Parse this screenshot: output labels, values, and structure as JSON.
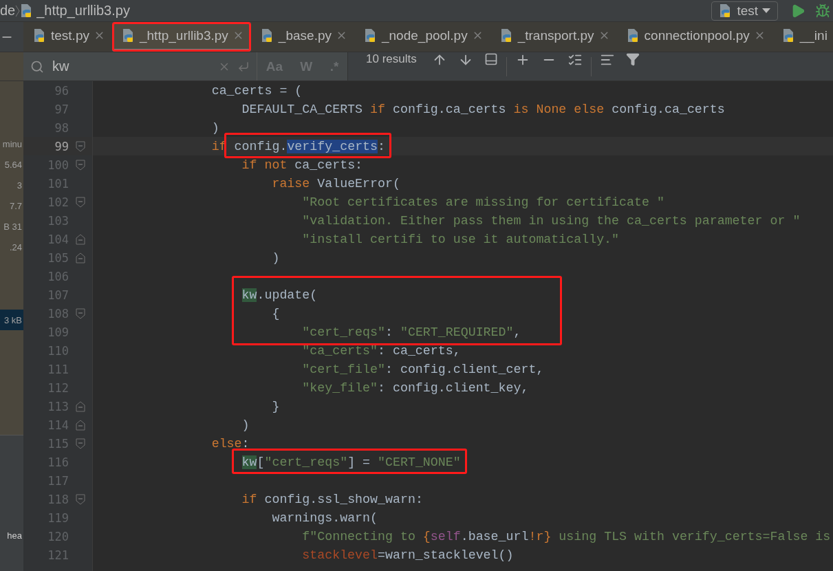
{
  "breadcrumb": {
    "items": [
      {
        "label": "de",
        "kind": "text"
      },
      {
        "label": "_http_urllib3.py",
        "kind": "file"
      }
    ]
  },
  "run_config": {
    "label": "test"
  },
  "tabs": [
    {
      "label": "test.py",
      "selected": false,
      "outlined": false
    },
    {
      "label": "_http_urllib3.py",
      "selected": true,
      "outlined": true
    },
    {
      "label": "_base.py",
      "selected": false,
      "outlined": false
    },
    {
      "label": "_node_pool.py",
      "selected": false,
      "outlined": false
    },
    {
      "label": "_transport.py",
      "selected": false,
      "outlined": false
    },
    {
      "label": "connectionpool.py",
      "selected": false,
      "outlined": false
    },
    {
      "label": "__ini",
      "selected": false,
      "outlined": false
    }
  ],
  "search": {
    "value": "kw",
    "toggles": [
      "Aa",
      "W",
      ".*"
    ],
    "results": "10 results"
  },
  "side_panel": {
    "top_items": [
      {
        "label": "minu",
        "selected": false
      },
      {
        "label": "5.64",
        "selected": false
      },
      {
        "label": "3",
        "selected": false
      },
      {
        "label": "7.7",
        "selected": false
      },
      {
        "label": "B 31",
        "selected": false
      },
      {
        "label": ".24",
        "selected": false
      },
      {
        "label": "3 kB",
        "selected": true
      }
    ],
    "bottom_items": [
      {
        "label": "hea",
        "selected": false
      }
    ]
  },
  "code": {
    "lines": [
      {
        "number": "96",
        "current": false,
        "tokens": [
          {
            "text": "            ca_certs = (",
            "kind": "plain"
          }
        ]
      },
      {
        "number": "97",
        "current": false,
        "tokens": [
          {
            "text": "                DEFAULT_CA_CERTS ",
            "kind": "plain"
          },
          {
            "text": "if",
            "kind": "keyword"
          },
          {
            "text": " config.ca_certs ",
            "kind": "plain"
          },
          {
            "text": "is",
            "kind": "keyword"
          },
          {
            "text": " None",
            "kind": "keyword"
          },
          {
            "text": " else",
            "kind": "keyword"
          },
          {
            "text": " config.ca_certs",
            "kind": "plain"
          }
        ]
      },
      {
        "number": "98",
        "current": false,
        "tokens": [
          {
            "text": "            )",
            "kind": "plain"
          }
        ]
      },
      {
        "number": "99",
        "current": true,
        "fold_start": true,
        "tokens": [
          {
            "text": "            if",
            "kind": "keyword"
          },
          {
            "text": " config.",
            "kind": "plain",
            "box_start": true
          },
          {
            "text": "verify_certs",
            "kind": "plain",
            "selected": true
          },
          {
            "text": ":",
            "kind": "plain",
            "box_end": true
          }
        ]
      },
      {
        "number": "100",
        "current": false,
        "fold_start": true,
        "tokens": [
          {
            "text": "                if not",
            "kind": "keyword"
          },
          {
            "text": " ca_certs:",
            "kind": "plain"
          }
        ]
      },
      {
        "number": "101",
        "current": false,
        "tokens": [
          {
            "text": "                    raise",
            "kind": "keyword"
          },
          {
            "text": " ValueError(",
            "kind": "plain"
          }
        ]
      },
      {
        "number": "102",
        "current": false,
        "fold_start": true,
        "tokens": [
          {
            "text": "                        \"Root certificates are missing for certificate \"",
            "kind": "string"
          }
        ]
      },
      {
        "number": "103",
        "current": false,
        "tokens": [
          {
            "text": "                        \"validation. Either pass them in using the ca_certs parameter or \"",
            "kind": "string"
          }
        ]
      },
      {
        "number": "104",
        "current": false,
        "fold_end": true,
        "tokens": [
          {
            "text": "                        \"install certifi to use it automatically.\"",
            "kind": "string"
          }
        ]
      },
      {
        "number": "105",
        "current": false,
        "fold_end": true,
        "tokens": [
          {
            "text": "                    )",
            "kind": "plain"
          }
        ]
      },
      {
        "number": "106",
        "current": false
      },
      {
        "number": "107",
        "current": false,
        "tokens": [
          {
            "text": "                kw",
            "kind": "plain",
            "match": true,
            "box_start": true
          },
          {
            "text": ".update(",
            "kind": "plain"
          }
        ]
      },
      {
        "number": "108",
        "current": false,
        "fold_start": true,
        "tokens": [
          {
            "text": "                    {",
            "kind": "plain"
          }
        ]
      },
      {
        "number": "109",
        "current": false,
        "tokens": [
          {
            "text": "                        \"cert_reqs\"",
            "kind": "string"
          },
          {
            "text": ": ",
            "kind": "plain"
          },
          {
            "text": "\"CERT_REQUIRED\"",
            "kind": "string"
          },
          {
            "text": ",",
            "kind": "plain",
            "box_end": true
          }
        ]
      },
      {
        "number": "110",
        "current": false,
        "tokens": [
          {
            "text": "                        \"ca_certs\"",
            "kind": "string"
          },
          {
            "text": ": ca_certs,",
            "kind": "plain"
          }
        ]
      },
      {
        "number": "111",
        "current": false,
        "tokens": [
          {
            "text": "                        \"cert_file\"",
            "kind": "string"
          },
          {
            "text": ": config.client_cert,",
            "kind": "plain"
          }
        ]
      },
      {
        "number": "112",
        "current": false,
        "tokens": [
          {
            "text": "                        \"key_file\"",
            "kind": "string"
          },
          {
            "text": ": config.client_key,",
            "kind": "plain"
          }
        ]
      },
      {
        "number": "113",
        "current": false,
        "fold_end": true,
        "tokens": [
          {
            "text": "                    }",
            "kind": "plain"
          }
        ]
      },
      {
        "number": "114",
        "current": false,
        "fold_end": true,
        "tokens": [
          {
            "text": "                )",
            "kind": "plain"
          }
        ]
      },
      {
        "number": "115",
        "current": false,
        "fold_start": true,
        "tokens": [
          {
            "text": "            else",
            "kind": "keyword"
          },
          {
            "text": ":",
            "kind": "plain"
          }
        ]
      },
      {
        "number": "116",
        "current": false,
        "tokens": [
          {
            "text": "                kw",
            "kind": "plain",
            "match": true,
            "box_start": true
          },
          {
            "text": "[",
            "kind": "plain"
          },
          {
            "text": "\"cert_reqs\"",
            "kind": "string"
          },
          {
            "text": "] = ",
            "kind": "plain"
          },
          {
            "text": "\"CERT_NONE\"",
            "kind": "string",
            "box_end": true
          }
        ]
      },
      {
        "number": "117",
        "current": false
      },
      {
        "number": "118",
        "current": false,
        "fold_start": true,
        "tokens": [
          {
            "text": "                if",
            "kind": "keyword"
          },
          {
            "text": " config.ssl_show_warn:",
            "kind": "plain"
          }
        ]
      },
      {
        "number": "119",
        "current": false,
        "tokens": [
          {
            "text": "                    warnings.warn(",
            "kind": "plain"
          }
        ]
      },
      {
        "number": "120",
        "current": false,
        "tokens": [
          {
            "text": "                        f\"Connecting to ",
            "kind": "string"
          },
          {
            "text": "{",
            "kind": "keyword"
          },
          {
            "text": "self",
            "kind": "self"
          },
          {
            "text": ".base_url",
            "kind": "plain"
          },
          {
            "text": "!r}",
            "kind": "keyword"
          },
          {
            "text": " using TLS with verify_certs=False is",
            "kind": "string"
          }
        ]
      },
      {
        "number": "121",
        "current": false,
        "tokens": [
          {
            "text": "                        stacklevel",
            "kind": "param"
          },
          {
            "text": "=warn_stacklevel()",
            "kind": "plain"
          }
        ]
      }
    ]
  }
}
